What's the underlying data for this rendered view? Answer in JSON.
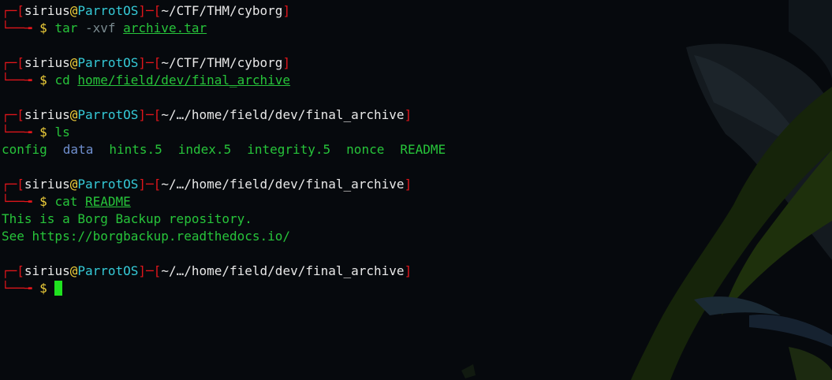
{
  "prompt": {
    "user": "sirius",
    "at": "@",
    "host": "ParrotOS"
  },
  "blocks": [
    {
      "path": "~/CTF/THM/cyborg",
      "command": {
        "name": "tar",
        "args": " -xvf ",
        "file": "archive.tar"
      }
    },
    {
      "path": "~/CTF/THM/cyborg",
      "command": {
        "name": "cd",
        "args": " ",
        "file": "home/field/dev/final_archive"
      }
    },
    {
      "path": "~/…/home/field/dev/final_archive",
      "command": {
        "name": "ls",
        "args": "",
        "file": ""
      },
      "ls_output": [
        "config",
        "data",
        "hints.5",
        "index.5",
        "integrity.5",
        "nonce",
        "README"
      ]
    },
    {
      "path": "~/…/home/field/dev/final_archive",
      "command": {
        "name": "cat",
        "args": " ",
        "file": "README"
      },
      "output": [
        "This is a Borg Backup repository.",
        "See https://borgbackup.readthedocs.io/"
      ]
    },
    {
      "path": "~/…/home/field/dev/final_archive",
      "command": {
        "name": "",
        "args": "",
        "file": ""
      }
    }
  ],
  "colors": {
    "background": "#06090d",
    "prompt_frame": "#e0161b",
    "host": "#35c9d6",
    "dollar": "#f0cf3a",
    "command": "#27c43a",
    "directory": "#6f8fce",
    "cursor": "#1fe21f"
  }
}
